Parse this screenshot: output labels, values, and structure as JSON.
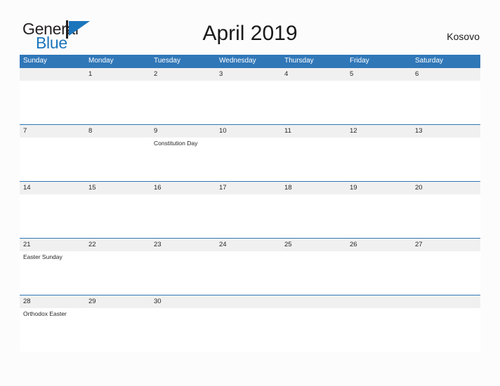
{
  "brand": {
    "name_part1": "General",
    "name_part2": "Blue",
    "logo_icon": "blue-flag-triangle-icon",
    "accent_color": "#1b75bb"
  },
  "header": {
    "title": "April 2019",
    "country": "Kosovo",
    "header_blue": "#3077b8",
    "daystrip_gray": "#f0f0f0"
  },
  "calendar": {
    "month": "April",
    "year": "2019",
    "weekday_headers": [
      "Sunday",
      "Monday",
      "Tuesday",
      "Wednesday",
      "Thursday",
      "Friday",
      "Saturday"
    ],
    "weeks": [
      {
        "days": [
          {
            "num": "",
            "event": ""
          },
          {
            "num": "1",
            "event": ""
          },
          {
            "num": "2",
            "event": ""
          },
          {
            "num": "3",
            "event": ""
          },
          {
            "num": "4",
            "event": ""
          },
          {
            "num": "5",
            "event": ""
          },
          {
            "num": "6",
            "event": ""
          }
        ]
      },
      {
        "days": [
          {
            "num": "7",
            "event": ""
          },
          {
            "num": "8",
            "event": ""
          },
          {
            "num": "9",
            "event": "Constitution Day"
          },
          {
            "num": "10",
            "event": ""
          },
          {
            "num": "11",
            "event": ""
          },
          {
            "num": "12",
            "event": ""
          },
          {
            "num": "13",
            "event": ""
          }
        ]
      },
      {
        "days": [
          {
            "num": "14",
            "event": ""
          },
          {
            "num": "15",
            "event": ""
          },
          {
            "num": "16",
            "event": ""
          },
          {
            "num": "17",
            "event": ""
          },
          {
            "num": "18",
            "event": ""
          },
          {
            "num": "19",
            "event": ""
          },
          {
            "num": "20",
            "event": ""
          }
        ]
      },
      {
        "days": [
          {
            "num": "21",
            "event": "Easter Sunday"
          },
          {
            "num": "22",
            "event": ""
          },
          {
            "num": "23",
            "event": ""
          },
          {
            "num": "24",
            "event": ""
          },
          {
            "num": "25",
            "event": ""
          },
          {
            "num": "26",
            "event": ""
          },
          {
            "num": "27",
            "event": ""
          }
        ]
      },
      {
        "days": [
          {
            "num": "28",
            "event": "Orthodox Easter"
          },
          {
            "num": "29",
            "event": ""
          },
          {
            "num": "30",
            "event": ""
          },
          {
            "num": "",
            "event": ""
          },
          {
            "num": "",
            "event": ""
          },
          {
            "num": "",
            "event": ""
          },
          {
            "num": "",
            "event": ""
          }
        ]
      }
    ]
  }
}
